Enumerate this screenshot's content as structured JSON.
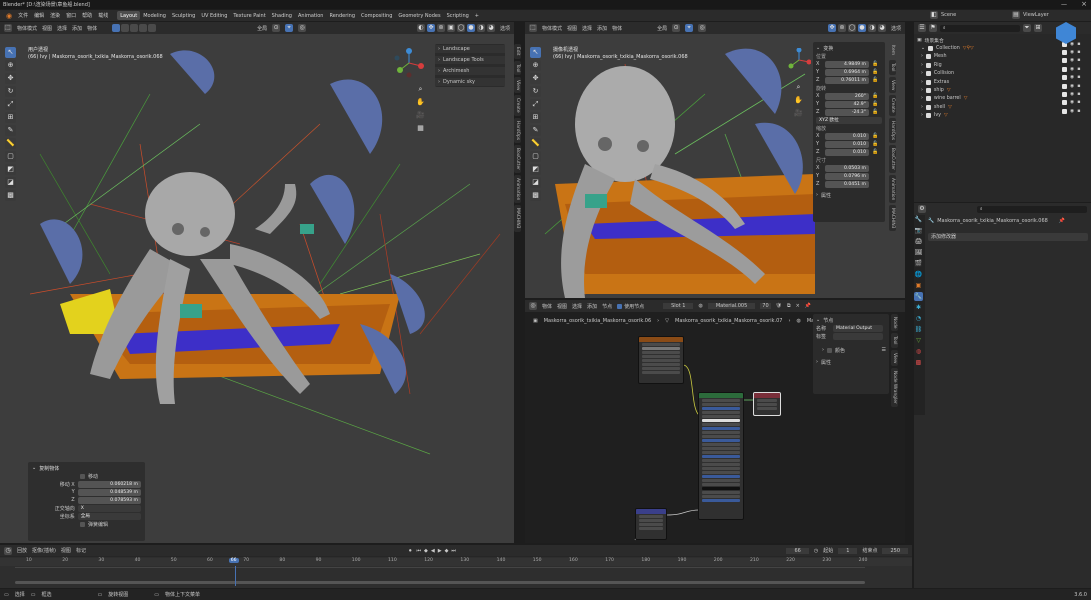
{
  "window_title": "Blender* [D:\\渲染场景\\章鱼船.blend]",
  "top_menu": [
    "文件",
    "编辑",
    "渲染",
    "窗口",
    "帮助",
    "载线"
  ],
  "workspaces": [
    "Layout",
    "Modeling",
    "Sculpting",
    "UV Editing",
    "Texture Paint",
    "Shading",
    "Animation",
    "Rendering",
    "Compositing",
    "Geometry Nodes",
    "Scripting"
  ],
  "active_workspace": "Layout",
  "add_tab": "+",
  "scene": {
    "label": "Scene",
    "view_layer": "ViewLayer"
  },
  "viewport_left": {
    "mode": "物体模式",
    "menus": [
      "视图",
      "选择",
      "添加",
      "物体"
    ],
    "orientation": "全局",
    "options": "选项",
    "view_name": "用户透视",
    "object_info": "(66) Ivy | Maskorra_osorik_txikia_Maskorra_osorik.068",
    "addon_menu": [
      "Landscape",
      "Landscape Tools",
      "Archimesh",
      "Dynamic sky"
    ]
  },
  "viewport_right": {
    "mode": "物体模式",
    "menus": [
      "视图",
      "选择",
      "添加",
      "物体"
    ],
    "orientation": "全局",
    "options": "选项",
    "view_name": "摄像机透视",
    "object_info": "(66) Ivy | Maskorra_osorik_txikia_Maskorra_osorik.068"
  },
  "left_side_tabs": [
    "Edit",
    "Tool",
    "View",
    "Create",
    "HardOps",
    "BoxCutter",
    "Animation",
    "MACHIN3"
  ],
  "right_side_tabs": [
    "Item",
    "Tool",
    "View",
    "Create",
    "HardOps",
    "BoxCutter",
    "Animation",
    "MACHIN3"
  ],
  "redo_panel": {
    "title": "复制物体",
    "checkbox": "移动",
    "axis_label": "移动 X",
    "x": "0.060218 m",
    "y": "0.048539 m",
    "z": "0.078593 m",
    "constraint_label": "正交轴向",
    "constraint_value": "X",
    "orient_label": "坐标系",
    "orient_value": "全局",
    "extra": "弹簧编辑"
  },
  "transform_panel": {
    "title": "变换",
    "location_label": "位置",
    "location": {
      "x": "4.9849 m",
      "y": "0.6964 m",
      "z": "0.76011 m"
    },
    "rotation_label": "旋转",
    "rotation": {
      "x": "260°",
      "y": "42.9°",
      "z": "-24.3°"
    },
    "rotation_mode": "XYZ 欧拉",
    "scale_label": "缩放",
    "scale": {
      "x": "0.010",
      "y": "0.010",
      "z": "0.010"
    },
    "dimensions_label": "尺寸",
    "dimensions": {
      "x": "0.0503 m",
      "y": "0.0796 m",
      "z": "0.0451 m"
    },
    "props": "属性"
  },
  "node_editor": {
    "menus": [
      "物体",
      "视图",
      "选择",
      "添加",
      "节点"
    ],
    "use_nodes": "使用节点",
    "slot": "Slot 1",
    "material": "Material.005",
    "users": "70",
    "breadcrumb": [
      "Maskorra_osorik_txikia_Maskorra_osorik.06",
      "Maskorra_osorik_txikia_Maskorra_osorik.07",
      "Material.005"
    ],
    "side": {
      "title": "节点",
      "name_label": "名称",
      "name_value": "Material Output",
      "label_label": "标签",
      "color": "颜色",
      "props": "属性"
    }
  },
  "outliner": {
    "title": "场景集合",
    "items": [
      "Collection",
      "Mesh",
      "Rig",
      "Collision",
      "Extras",
      "ship",
      "wine barrel",
      "shell",
      "Ivy"
    ]
  },
  "properties": {
    "object": "Maskorra_osorik_txikia_Maskorra_osorik.068",
    "modifier": "添加修改器"
  },
  "timeline": {
    "menus": [
      "回放",
      "抠像(插帧)",
      "视图",
      "标记"
    ],
    "ticks": [
      "10",
      "20",
      "30",
      "40",
      "50",
      "60",
      "66",
      "70",
      "80",
      "90",
      "100",
      "110",
      "120",
      "130",
      "140",
      "150",
      "160",
      "170",
      "180",
      "190",
      "200",
      "210",
      "220",
      "230",
      "240"
    ],
    "current": "66",
    "start_label": "起始",
    "start": "1",
    "end_label": "结束点",
    "end": "250"
  },
  "status": {
    "select": "选择",
    "box": "框选",
    "rotate": "旋转视图",
    "menu": "物体上下文菜单",
    "version": "3.6.0"
  },
  "colors": {
    "accent": "#4772b3",
    "orange": "#e07b2a",
    "bg": "#1d1d1d",
    "viewport": "#3d3d3d"
  }
}
